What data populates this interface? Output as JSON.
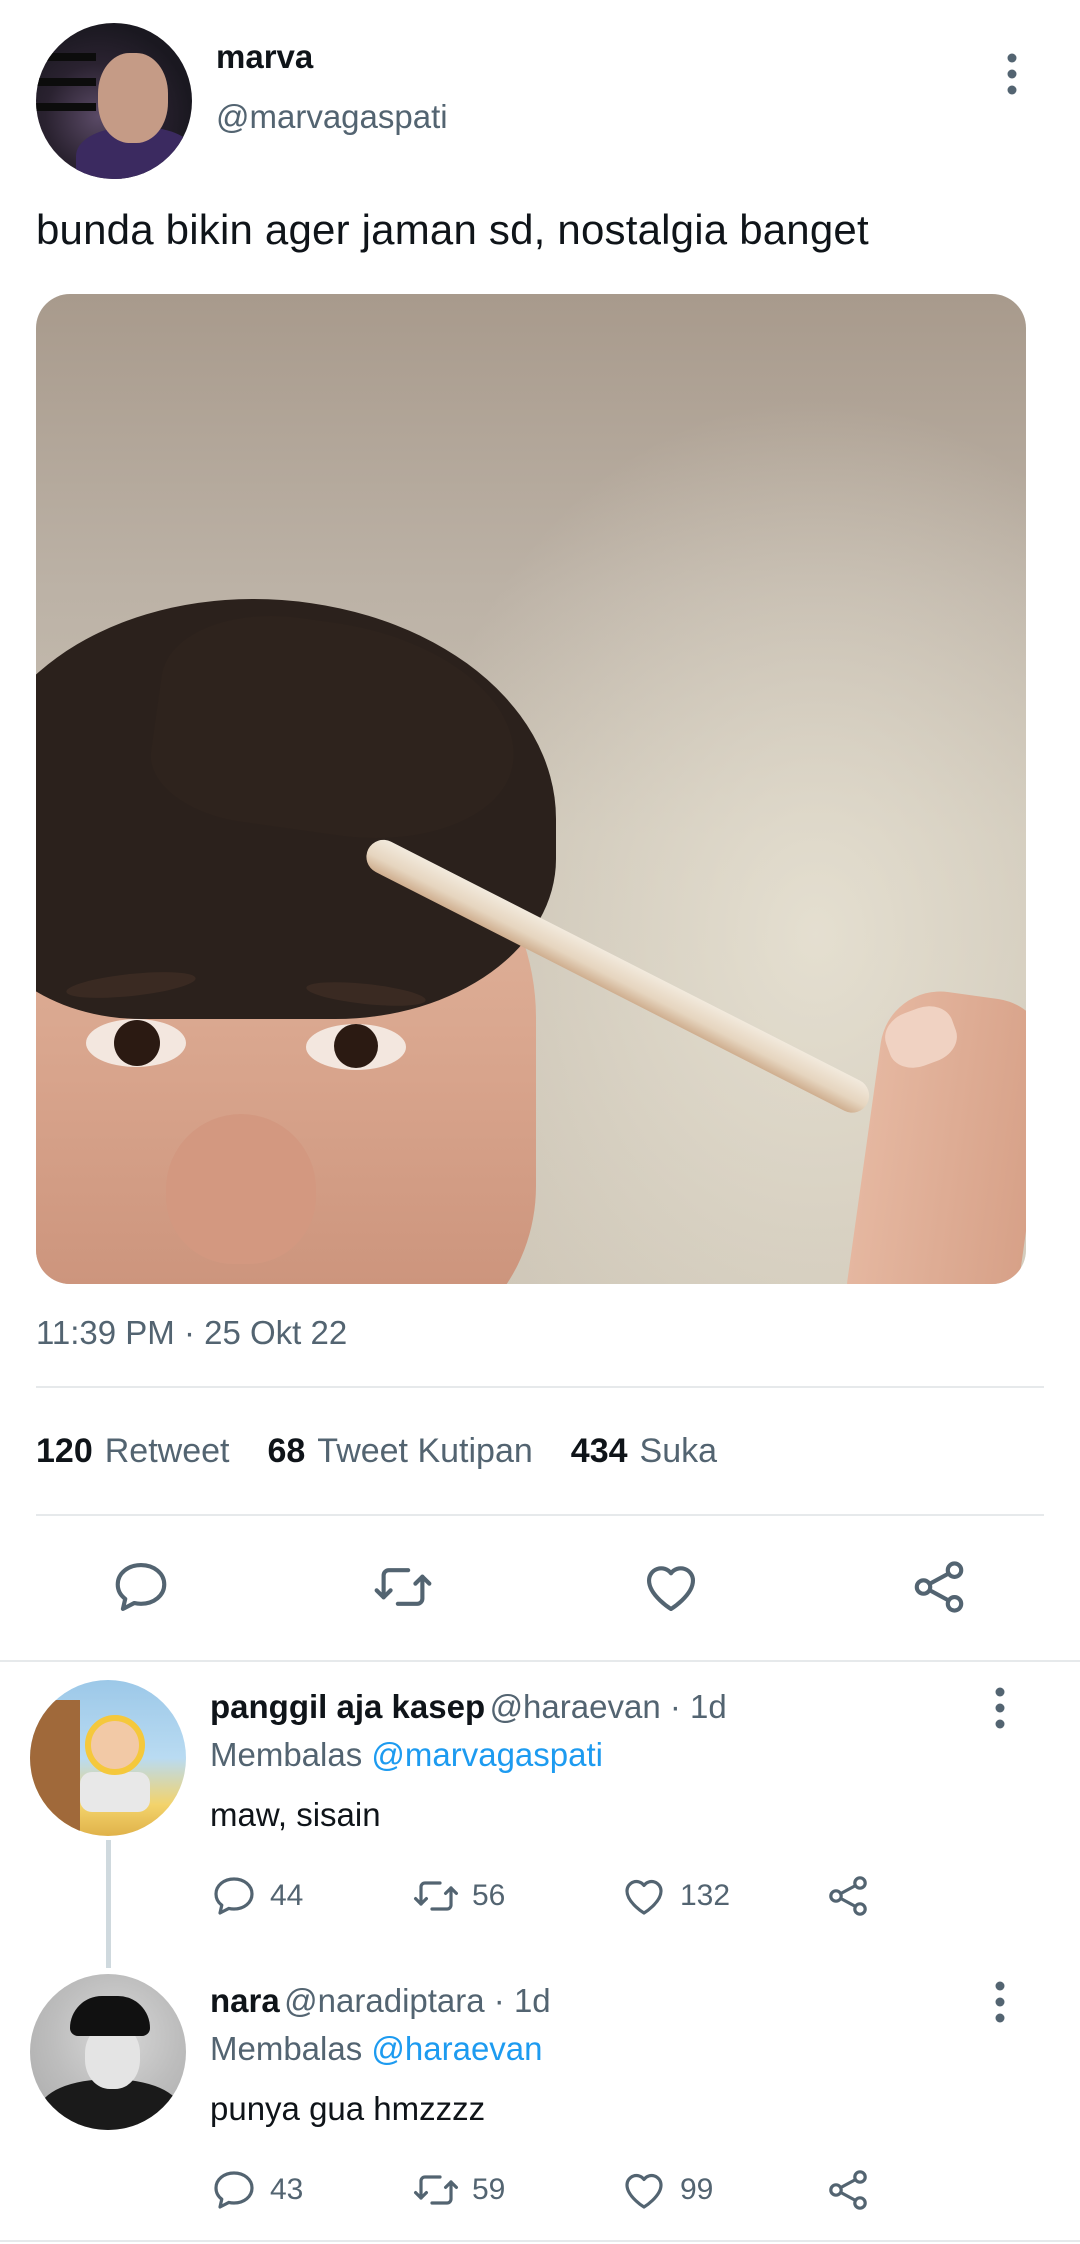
{
  "tweet": {
    "author": {
      "name": "marva",
      "handle": "@marvagaspati",
      "avatar_icon": "user-avatar"
    },
    "text": "bunda bikin ager jaman sd, nostalgia banget",
    "timestamp": "11:39 PM · 25 Okt 22",
    "stats": [
      {
        "count": "120",
        "label": "Retweet"
      },
      {
        "count": "68",
        "label": "Tweet Kutipan"
      },
      {
        "count": "434",
        "label": "Suka"
      }
    ],
    "actions": [
      "reply-icon",
      "retweet-icon",
      "like-icon",
      "share-icon"
    ]
  },
  "replies": [
    {
      "name": "panggil aja kasep",
      "handle_time": "@haraevan · 1d",
      "replying_prefix": "Membalas ",
      "replying_to": "@marvagaspati",
      "text": "maw, sisain",
      "counts": {
        "reply": "44",
        "retweet": "56",
        "like": "132"
      }
    },
    {
      "name": "nara",
      "handle_time": "@naradiptara · 1d",
      "replying_prefix": "Membalas ",
      "replying_to": "@haraevan",
      "text": "punya gua hmzzzz",
      "counts": {
        "reply": "43",
        "retweet": "59",
        "like": "99"
      }
    }
  ],
  "colors": {
    "text": "#0f1419",
    "secondary": "#536471",
    "link": "#1d9bf0",
    "divider": "#e6e9eb"
  }
}
